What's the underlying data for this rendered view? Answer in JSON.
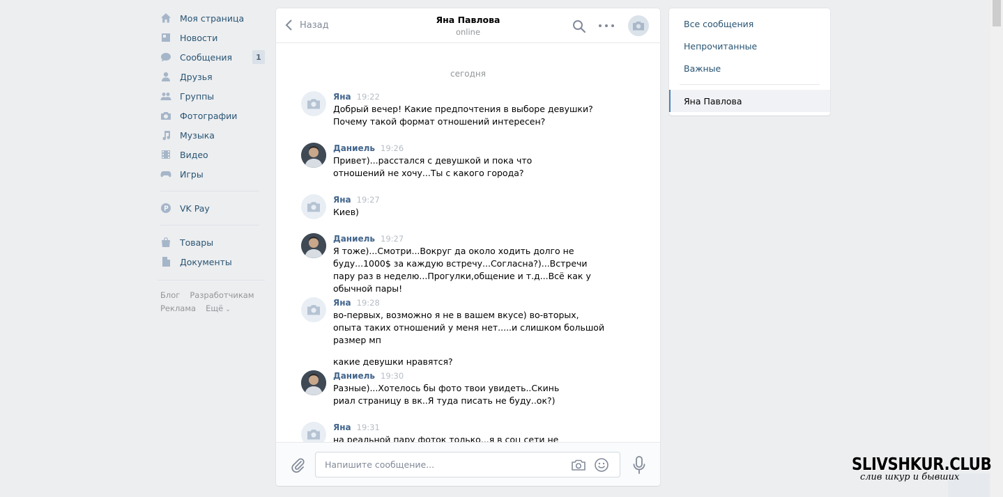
{
  "left_nav": {
    "items": [
      {
        "label": "Моя страница",
        "icon": "home-icon"
      },
      {
        "label": "Новости",
        "icon": "news-icon"
      },
      {
        "label": "Сообщения",
        "icon": "messages-icon",
        "counter": "1"
      },
      {
        "label": "Друзья",
        "icon": "friends-icon"
      },
      {
        "label": "Группы",
        "icon": "groups-icon"
      },
      {
        "label": "Фотографии",
        "icon": "photos-icon"
      },
      {
        "label": "Музыка",
        "icon": "music-icon"
      },
      {
        "label": "Видео",
        "icon": "video-icon"
      },
      {
        "label": "Игры",
        "icon": "games-icon"
      },
      {
        "label": "VK Pay",
        "icon": "vkpay-icon"
      },
      {
        "label": "Товары",
        "icon": "goods-icon"
      },
      {
        "label": "Документы",
        "icon": "documents-icon"
      }
    ],
    "footer": {
      "blog": "Блог",
      "developers": "Разработчикам",
      "ads": "Реклама",
      "more": "Ещё"
    }
  },
  "chat": {
    "back_label": "Назад",
    "peer_name": "Яна Павлова",
    "peer_status": "online",
    "date_separator": "сегодня",
    "messages": [
      {
        "author": "Яна",
        "time": "19:22",
        "avatar": "camera-placeholder",
        "text": "Добрый вечер! Какие предпочтения в выборе девушки?\nПочему такой формат отношений интересен?"
      },
      {
        "author": "Даниель",
        "time": "19:26",
        "avatar": "photo",
        "text": "Привет)...расстался с девушкой и пока что отношений не хочу...Ты с какого города?"
      },
      {
        "author": "Яна",
        "time": "19:27",
        "avatar": "camera-placeholder",
        "text": "Киев)"
      },
      {
        "author": "Даниель",
        "time": "19:27",
        "avatar": "photo",
        "text": "Я тоже)...Смотри...Вокруг да около ходить долго не буду...1000$ за каждую встречу...Согласна?)...Встречи пару раз в неделю...Прогулки,общение и т.д...Всё как у обычной пары!"
      },
      {
        "author": "Яна",
        "time": "19:28",
        "avatar": "camera-placeholder",
        "text": "во-первых, возможно я не в вашем вкусе) во-вторых, опыта таких отношений у меня нет.....и слишком большой размер мп",
        "text2": "какие девушки нравятся?"
      },
      {
        "author": "Даниель",
        "time": "19:30",
        "avatar": "photo",
        "text": "Разные)...Хотелось бы фото твои увидеть..Скинь риал страницу в вк..Я туда писать не буду..ок?)"
      },
      {
        "author": "Яна",
        "time": "19:31",
        "avatar": "camera-placeholder",
        "text": "на реальной пару фоток только...я в соц сети не выкладываю"
      }
    ],
    "composer": {
      "placeholder": "Напишите сообщение..."
    }
  },
  "right_menu": {
    "items": [
      "Все сообщения",
      "Непрочитанные",
      "Важные"
    ],
    "active_chat": "Яна Павлова"
  },
  "watermark": {
    "title": "SLIVSHKUR.CLUB",
    "subtitle": "слив шкур и бывших"
  },
  "colors": {
    "background": "#edeef0",
    "link": "#285473",
    "author": "#42648b",
    "accent": "#5181b8"
  }
}
